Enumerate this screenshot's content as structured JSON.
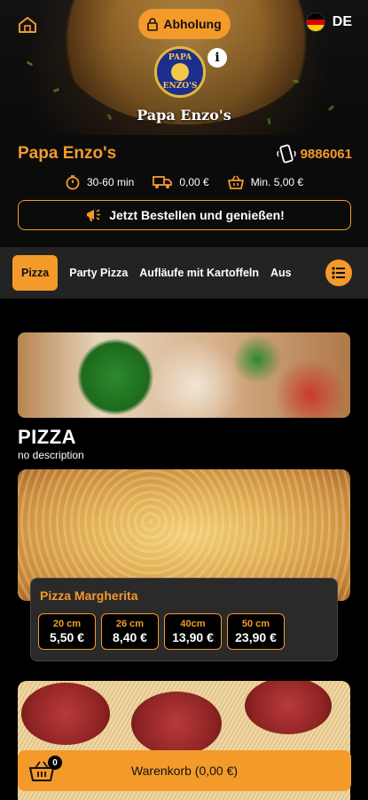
{
  "header": {
    "pickup_label": "Abholung",
    "language": "DE",
    "brand_name": "Papa Enzo's",
    "logo_text_top": "PAPA",
    "logo_text_bottom": "ENZO'S",
    "info_symbol": "i"
  },
  "restaurant": {
    "name": "Papa Enzo's",
    "phone": "9886061",
    "delivery_time": "30-60 min",
    "delivery_fee": "0,00 €",
    "min_order": "Min. 5,00 €",
    "order_cta": "Jetzt Bestellen und genießen!"
  },
  "categories": {
    "items": [
      "Pizza",
      "Party Pizza",
      "Aufläufe mit Kartoffeln",
      "Aus"
    ],
    "active_index": 0
  },
  "section": {
    "title": "PIZZA",
    "description": "no description"
  },
  "product": {
    "name": "Pizza Margherita",
    "prices": [
      {
        "size": "20 cm",
        "amount": "5,50 €"
      },
      {
        "size": "26 cm",
        "amount": "8,40 €"
      },
      {
        "size": "40cm",
        "amount": "13,90 €"
      },
      {
        "size": "50 cm",
        "amount": "23,90 €"
      }
    ]
  },
  "cart": {
    "label": "Warenkorb (0,00 €)",
    "count": "0"
  },
  "icons": {
    "home": "home-icon",
    "lock": "lock-icon",
    "flag": "germany-flag-icon",
    "info": "info-icon",
    "phone": "phone-icon",
    "timer": "timer-icon",
    "truck": "delivery-truck-icon",
    "basket": "basket-icon",
    "megaphone": "megaphone-icon",
    "menu": "category-list-icon",
    "cart": "cart-icon"
  },
  "colors": {
    "accent": "#f39a2b",
    "background": "#000000",
    "category_bar": "#232323"
  }
}
